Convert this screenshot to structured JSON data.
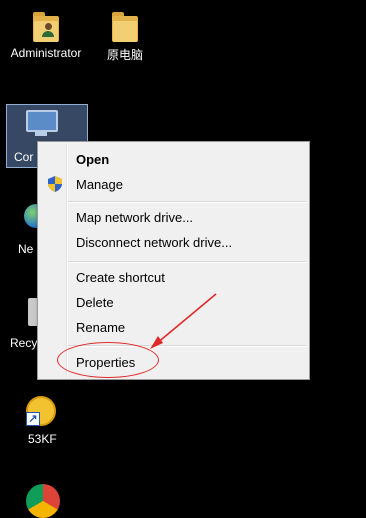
{
  "desktop": {
    "icons": [
      {
        "label": "Administrator",
        "icon": "user-folder-icon"
      },
      {
        "label": "原电脑",
        "icon": "folder-icon"
      },
      {
        "label": "Cor",
        "icon": "computer-icon"
      },
      {
        "label": "Ne",
        "icon": "network-icon"
      },
      {
        "label": "Recy",
        "icon": "recycle-bin-icon"
      },
      {
        "label": "53KF",
        "icon": "shortcut-app-icon"
      },
      {
        "label": "",
        "icon": "chrome-icon"
      }
    ]
  },
  "context_menu": {
    "groups": [
      [
        {
          "label": "Open",
          "bold": true
        },
        {
          "label": "Manage",
          "icon": "uac-shield-icon"
        }
      ],
      [
        {
          "label": "Map network drive..."
        },
        {
          "label": "Disconnect network drive..."
        }
      ],
      [
        {
          "label": "Create shortcut"
        },
        {
          "label": "Delete"
        },
        {
          "label": "Rename"
        }
      ],
      [
        {
          "label": "Properties",
          "highlighted_by_annotation": true
        }
      ]
    ]
  },
  "annotation": {
    "color": "#e02a2a",
    "type": "arrow-and-ellipse",
    "target": "Properties"
  }
}
